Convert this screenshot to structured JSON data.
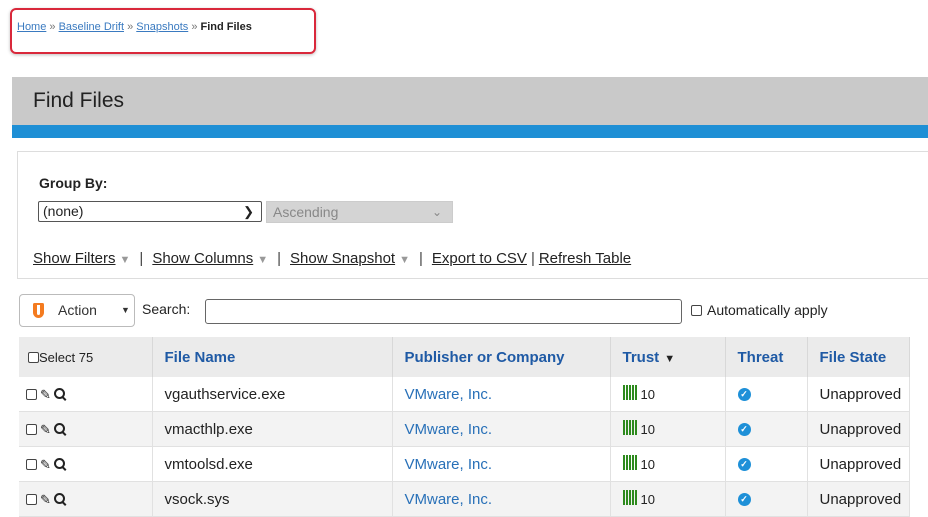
{
  "breadcrumb": {
    "home": "Home",
    "sep": "»",
    "baseline_drift": "Baseline Drift",
    "snapshots": "Snapshots",
    "current": "Find Files"
  },
  "page": {
    "title": "Find Files"
  },
  "group_by": {
    "label": "Group By:",
    "value": "(none)",
    "order": "Ascending"
  },
  "links": {
    "show_filters": "Show Filters",
    "show_columns": "Show Columns",
    "show_snapshot": "Show Snapshot",
    "export_csv": "Export to CSV",
    "refresh_table": "Refresh Table"
  },
  "toolbar": {
    "action_label": "Action",
    "search_label": "Search:",
    "search_value": "",
    "auto_apply_label": "Automatically apply"
  },
  "table": {
    "select_label": "Select 75",
    "columns": [
      "File Name",
      "Publisher or Company",
      "Trust",
      "Threat",
      "File State"
    ],
    "rows": [
      {
        "file_name": "vgauthservice.exe",
        "publisher": "VMware, Inc.",
        "trust": "10",
        "state": "Unapproved"
      },
      {
        "file_name": "vmacthlp.exe",
        "publisher": "VMware, Inc.",
        "trust": "10",
        "state": "Unapproved"
      },
      {
        "file_name": "vmtoolsd.exe",
        "publisher": "VMware, Inc.",
        "trust": "10",
        "state": "Unapproved"
      },
      {
        "file_name": "vsock.sys",
        "publisher": "VMware, Inc.",
        "trust": "10",
        "state": "Unapproved"
      }
    ]
  },
  "colors": {
    "accent_blue": "#1e8fd5",
    "highlight_red": "#d9283b",
    "trust_green": "#2e8b1e",
    "action_orange": "#f47b20"
  }
}
